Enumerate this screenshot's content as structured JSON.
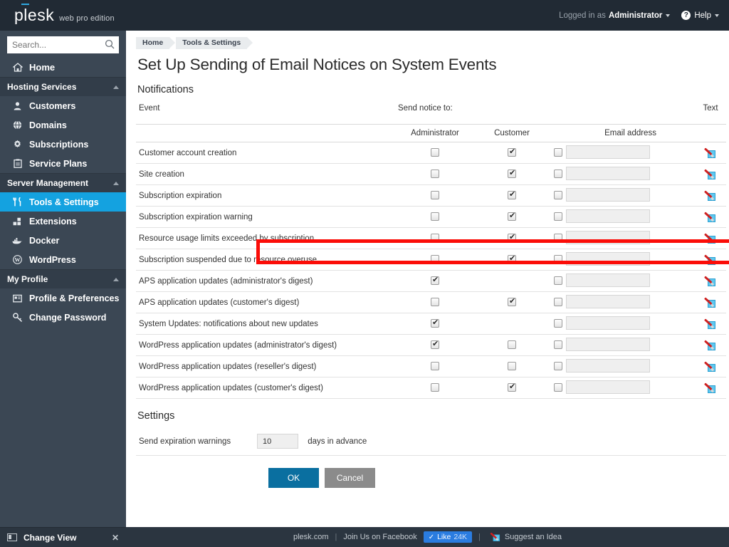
{
  "header": {
    "logo_text": "plesk",
    "logo_edition": "web pro edition",
    "logged_in_label": "Logged in as",
    "user": "Administrator",
    "help": "Help",
    "help_icon": "question-circle-icon",
    "caret_icon": "chevron-down-icon"
  },
  "sidebar": {
    "search": {
      "placeholder": "Search...",
      "value": "",
      "icon": "search-icon"
    },
    "home": {
      "label": "Home",
      "icon": "home-icon"
    },
    "groups": [
      {
        "label": "Hosting Services",
        "collapse_icon": "chevron-up-icon",
        "items": [
          {
            "label": "Customers",
            "icon": "user-icon"
          },
          {
            "label": "Domains",
            "icon": "globe-icon"
          },
          {
            "label": "Subscriptions",
            "icon": "gear-icon"
          },
          {
            "label": "Service Plans",
            "icon": "clipboard-icon"
          }
        ]
      },
      {
        "label": "Server Management",
        "collapse_icon": "chevron-up-icon",
        "items": [
          {
            "label": "Tools & Settings",
            "icon": "tools-icon",
            "active": true
          },
          {
            "label": "Extensions",
            "icon": "blocks-icon"
          },
          {
            "label": "Docker",
            "icon": "whale-icon"
          },
          {
            "label": "WordPress",
            "icon": "wordpress-icon"
          }
        ]
      },
      {
        "label": "My Profile",
        "collapse_icon": "chevron-up-icon",
        "items": [
          {
            "label": "Profile & Preferences",
            "icon": "id-card-icon"
          },
          {
            "label": "Change Password",
            "icon": "key-icon"
          }
        ]
      }
    ],
    "change_view": {
      "label": "Change View",
      "icon": "layout-icon",
      "close_icon": "close-icon"
    }
  },
  "breadcrumb": [
    "Home",
    "Tools & Settings"
  ],
  "page_title": "Set Up Sending of Email Notices on System Events",
  "notifications": {
    "heading": "Notifications",
    "col_event": "Event",
    "col_sendto": "Send notice to:",
    "col_text": "Text",
    "col_admin": "Administrator",
    "col_customer": "Customer",
    "col_email": "Email address",
    "edit_icon": "edit-note-icon",
    "rows": [
      {
        "event": "Customer account creation",
        "admin": false,
        "customer": true,
        "has_customer": true,
        "other": false,
        "email": ""
      },
      {
        "event": "Site creation",
        "admin": false,
        "customer": true,
        "has_customer": true,
        "other": false,
        "email": ""
      },
      {
        "event": "Subscription expiration",
        "admin": false,
        "customer": true,
        "has_customer": true,
        "other": false,
        "email": ""
      },
      {
        "event": "Subscription expiration warning",
        "admin": false,
        "customer": true,
        "has_customer": true,
        "other": false,
        "email": ""
      },
      {
        "event": "Resource usage limits exceeded by subscription",
        "admin": false,
        "customer": true,
        "has_customer": true,
        "other": false,
        "email": "",
        "highlighted": true
      },
      {
        "event": "Subscription suspended due to resource overuse",
        "admin": false,
        "customer": true,
        "has_customer": true,
        "other": false,
        "email": ""
      },
      {
        "event": "APS application updates (administrator's digest)",
        "admin": true,
        "customer": false,
        "has_customer": false,
        "other": false,
        "email": ""
      },
      {
        "event": "APS application updates (customer's digest)",
        "admin": false,
        "customer": true,
        "has_customer": true,
        "other": false,
        "email": ""
      },
      {
        "event": "System Updates: notifications about new updates",
        "admin": true,
        "customer": false,
        "has_customer": false,
        "other": false,
        "email": ""
      },
      {
        "event": "WordPress application updates (administrator's digest)",
        "admin": true,
        "customer": false,
        "has_customer": true,
        "other": false,
        "email": ""
      },
      {
        "event": "WordPress application updates (reseller's digest)",
        "admin": false,
        "customer": false,
        "has_customer": true,
        "other": false,
        "email": ""
      },
      {
        "event": "WordPress application updates (customer's digest)",
        "admin": false,
        "customer": true,
        "has_customer": true,
        "other": false,
        "email": ""
      }
    ]
  },
  "settings": {
    "heading": "Settings",
    "expiration_label": "Send expiration warnings",
    "expiration_value": "10",
    "expiration_suffix": "days in advance",
    "ok_label": "OK",
    "cancel_label": "Cancel"
  },
  "footer": {
    "site": "plesk.com",
    "facebook": "Join Us on Facebook",
    "like_label": "Like",
    "like_count": "24K",
    "like_check_icon": "check-icon",
    "suggest": "Suggest an Idea",
    "suggest_icon": "edit-note-icon"
  },
  "colors": {
    "header_bg": "#212a34",
    "sidebar_bg": "#3b4754",
    "sidebar_group_bg": "#323d49",
    "accent_active": "#14a2e0",
    "button_primary": "#0a6fa0",
    "button_secondary": "#8b8b8b",
    "highlight_box": "#fb0d08",
    "footer_bg": "#2b3540",
    "facebook_blue": "#2a7ce0"
  }
}
